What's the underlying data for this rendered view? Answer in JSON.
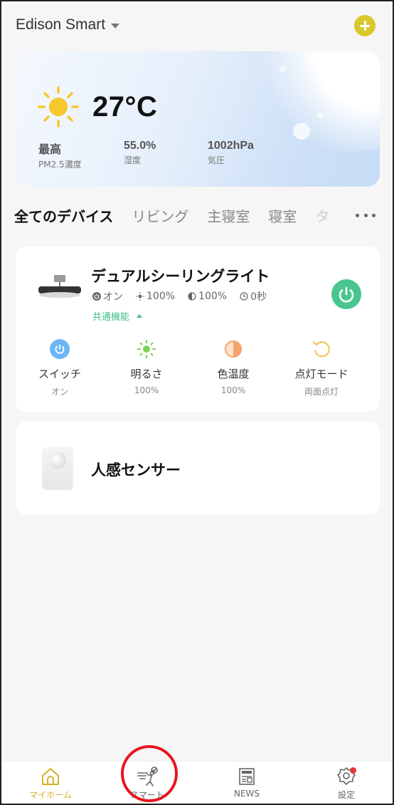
{
  "header": {
    "home_name": "Edison Smart",
    "add_icon": "plus-circle-icon"
  },
  "weather": {
    "condition_icon": "sun-icon",
    "temperature": "27°C",
    "stats": [
      {
        "value": "最高",
        "label": "PM2.5濃度"
      },
      {
        "value": "55.0%",
        "label": "湿度"
      },
      {
        "value": "1002hPa",
        "label": "気圧"
      }
    ]
  },
  "tabs": [
    {
      "label": "全てのデバイス",
      "active": true
    },
    {
      "label": "リビング"
    },
    {
      "label": "主寝室"
    },
    {
      "label": "寝室"
    },
    {
      "label": "タ"
    }
  ],
  "devices": [
    {
      "name": "デュアルシーリングライト",
      "status": [
        "オン",
        "100%",
        "100%",
        "0秒"
      ],
      "common_functions": "共通機能",
      "power_color": "#49c58f",
      "features": [
        {
          "name": "スイッチ",
          "value": "オン",
          "icon": "power-icon"
        },
        {
          "name": "明るさ",
          "value": "100%",
          "icon": "brightness-icon"
        },
        {
          "name": "色温度",
          "value": "100%",
          "icon": "color-temp-icon"
        },
        {
          "name": "点灯モード",
          "value": "両面点灯",
          "icon": "lighting-mode-icon"
        }
      ]
    },
    {
      "name": "人感センサー"
    }
  ],
  "bottom_nav": [
    {
      "label": "マイホーム",
      "icon": "home-icon",
      "active": true
    },
    {
      "label": "スマート",
      "icon": "smart-scene-icon"
    },
    {
      "label": "NEWS",
      "icon": "news-icon"
    },
    {
      "label": "設定",
      "icon": "settings-icon"
    }
  ],
  "colors": {
    "accent": "#d9c72c",
    "green": "#3fbf86",
    "annotation": "#e8141d"
  }
}
